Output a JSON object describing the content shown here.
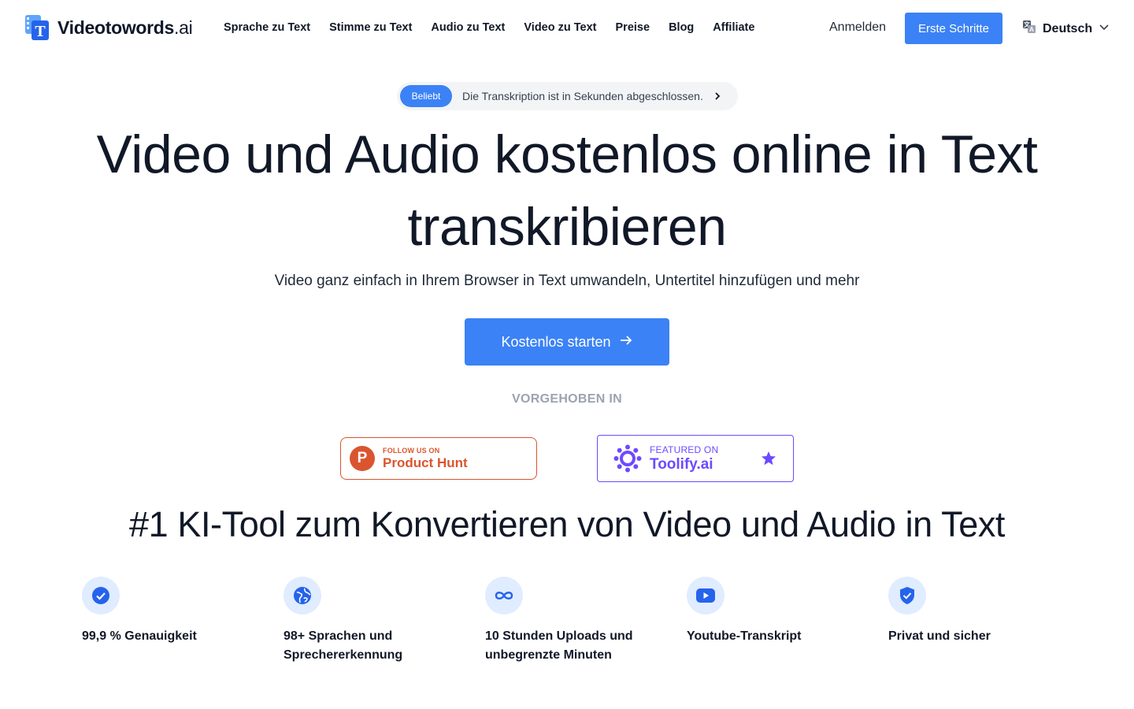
{
  "brand": {
    "name_main": "Videotowords",
    "name_suffix": ".ai",
    "accent": "#3b82f6"
  },
  "nav": {
    "items": [
      {
        "label": "Sprache zu Text"
      },
      {
        "label": "Stimme zu Text"
      },
      {
        "label": "Audio zu Text"
      },
      {
        "label": "Video zu Text"
      },
      {
        "label": "Preise"
      },
      {
        "label": "Blog"
      },
      {
        "label": "Affiliate"
      }
    ],
    "signin_label": "Anmelden",
    "get_started_label": "Erste Schritte",
    "language_label": "Deutsch",
    "language_icon": "translate-icon"
  },
  "announcement": {
    "badge": "Beliebt",
    "text": "Die Transkription ist in Sekunden abgeschlossen."
  },
  "hero": {
    "title": "Video und Audio kostenlos online in Text transkribieren",
    "subtitle": "Video ganz einfach in Ihrem Browser in Text umwandeln, Untertitel hinzufügen und mehr",
    "cta_label": "Kostenlos starten"
  },
  "featured": {
    "label": "VORGEHOBEN IN",
    "product_hunt": {
      "small": "FOLLOW US ON",
      "big": "Product Hunt",
      "color": "#da552f"
    },
    "toolify": {
      "small": "FEATURED ON",
      "big": "Toolify.ai",
      "color": "#6d4aff"
    }
  },
  "features": {
    "title": "#1 KI-Tool zum Konvertieren von Video und Audio in Text",
    "items": [
      {
        "icon": "check-circle-icon",
        "label": "99,9 % Genauigkeit"
      },
      {
        "icon": "globe-icon",
        "label": "98+ Sprachen und Sprechererkennung"
      },
      {
        "icon": "infinity-icon",
        "label": "10 Stunden Uploads und unbegrenzte Minuten"
      },
      {
        "icon": "youtube-icon",
        "label": "Youtube-Transkript"
      },
      {
        "icon": "shield-check-icon",
        "label": "Privat und sicher"
      }
    ]
  }
}
